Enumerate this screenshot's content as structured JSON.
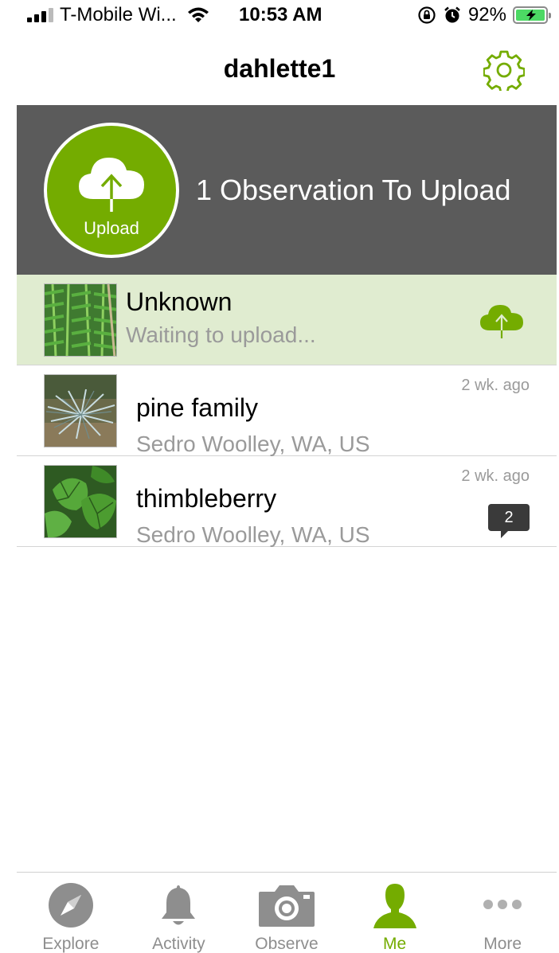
{
  "status_bar": {
    "carrier": "T-Mobile Wi...",
    "time": "10:53 AM",
    "battery": "92%",
    "icons": [
      "signal-icon",
      "wifi-icon",
      "rotation-lock-icon",
      "alarm-icon",
      "battery-charging-icon"
    ]
  },
  "nav": {
    "title": "dahlette1",
    "settings_icon": "gear-icon"
  },
  "banner": {
    "button_label": "Upload",
    "message": "1 Observation To Upload"
  },
  "observations": [
    {
      "title": "Unknown",
      "subtitle": "Waiting to upload...",
      "time": "",
      "comments": "",
      "state": "pending"
    },
    {
      "title": "pine family",
      "subtitle": "Sedro Woolley, WA, US",
      "time": "2 wk. ago",
      "comments": "",
      "state": "uploaded"
    },
    {
      "title": "thimbleberry",
      "subtitle": "Sedro Woolley, WA, US",
      "time": "2 wk. ago",
      "comments": "2",
      "state": "uploaded"
    }
  ],
  "tabs": [
    {
      "label": "Explore",
      "icon": "compass-icon"
    },
    {
      "label": "Activity",
      "icon": "bell-icon"
    },
    {
      "label": "Observe",
      "icon": "camera-icon"
    },
    {
      "label": "Me",
      "icon": "person-icon",
      "active": true
    },
    {
      "label": "More",
      "icon": "more-icon"
    }
  ],
  "colors": {
    "accent": "#74ac00",
    "banner_bg": "#5b5b5b",
    "pending_row_bg": "#e0ecd0",
    "muted_text": "#9a9a9a",
    "tab_inactive": "#8e8e8e"
  }
}
